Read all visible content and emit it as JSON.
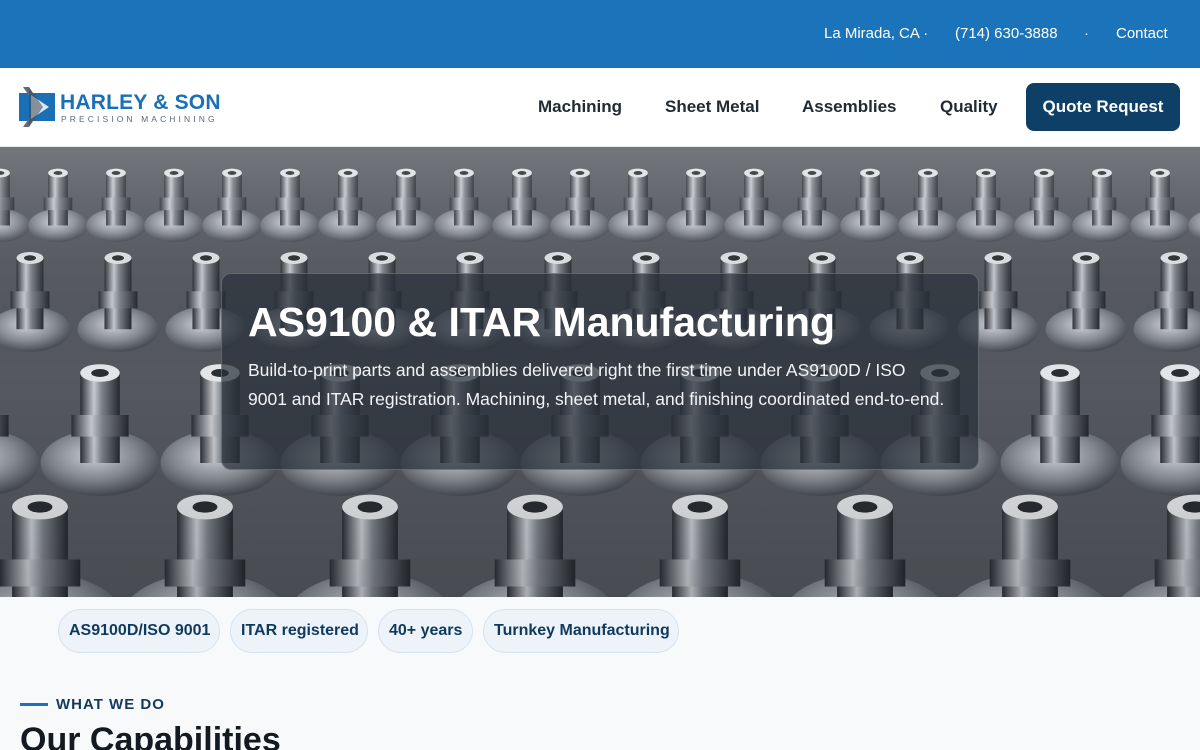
{
  "topbar": {
    "location": "La Mirada, CA ·",
    "phone": "(714) 630-3888",
    "separator": "·",
    "contact": "Contact"
  },
  "header": {
    "logo": {
      "name": "HARLEY & SON",
      "tagline": "PRECISION MACHINING"
    },
    "nav": [
      {
        "label": "Machining"
      },
      {
        "label": "Sheet Metal"
      },
      {
        "label": "Assemblies"
      },
      {
        "label": "Quality"
      }
    ],
    "cta_label": "Quote Request"
  },
  "hero": {
    "title": "AS9100 & ITAR Manufacturing",
    "description": "Build-to-print parts and assemblies delivered right the first time under AS9100D / ISO 9001 and ITAR registration. Machining, sheet metal, and finishing coordinated end-to-end."
  },
  "badges": [
    {
      "label": "AS9100D/ISO 9001"
    },
    {
      "label": "ITAR registered"
    },
    {
      "label": "40+ years"
    },
    {
      "label": "Turnkey Manufacturing"
    }
  ],
  "capabilities": {
    "eyebrow": "WHAT WE DO",
    "title": "Our Capabilities"
  },
  "colors": {
    "topbar_bg": "#1b73b9",
    "brand_blue": "#1a6fb5",
    "cta_bg": "#0e3f66",
    "badge_bg": "#edf3f9",
    "badge_text": "#0f3a5f"
  },
  "icons": [
    "logo-mark-icon"
  ]
}
